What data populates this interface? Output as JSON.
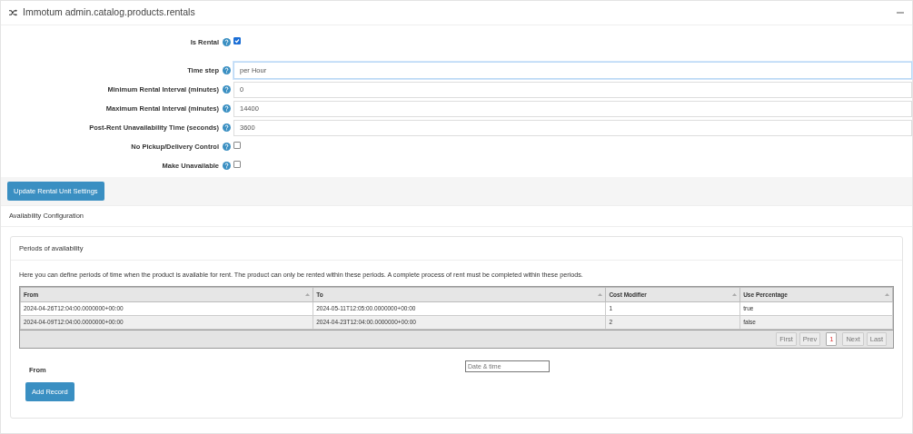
{
  "panel": {
    "title": "Immotum admin.catalog.products.rentals"
  },
  "form": {
    "fields": [
      {
        "kind": "checkbox",
        "label": "Is Rental",
        "checked": true
      },
      {
        "kind": "select",
        "label": "Time step",
        "value": "per Hour",
        "focused": true
      },
      {
        "kind": "text",
        "label": "Minimum Rental Interval (minutes)",
        "value": "0"
      },
      {
        "kind": "text",
        "label": "Maximum Rental Interval (minutes)",
        "value": "14400"
      },
      {
        "kind": "text",
        "label": "Post-Rent Unavailability Time (seconds)",
        "value": "3600"
      },
      {
        "kind": "checkbox",
        "label": "No Pickup/Delivery Control",
        "checked": false
      },
      {
        "kind": "checkbox",
        "label": "Make Unavailable",
        "checked": false
      }
    ],
    "submit": "Update Rental Unit Settings"
  },
  "availability": {
    "title": "Availability Configuration",
    "periods": {
      "title": "Periods of availability",
      "description": "Here you can define periods of time when the product is available for rent. The product can only be rented within these periods. A complete process of rent must be completed within these periods.",
      "table": {
        "columns": [
          "From",
          "To",
          "Cost Modifier",
          "Use Percentage"
        ],
        "rows": [
          [
            "2024-04-26T12:04:00.0000000+00:00",
            "2024-05-11T12:05:00.0000000+00:00",
            "1",
            "true"
          ],
          [
            "2024-04-09T12:04:00.0000000+00:00",
            "2024-04-23T12:04:00.0000000+00:00",
            "2",
            "false"
          ]
        ]
      },
      "pager": [
        {
          "label": "First",
          "selected": false,
          "disabled": true
        },
        {
          "label": "Prev",
          "selected": false,
          "disabled": true
        },
        {
          "label": "1",
          "selected": true,
          "disabled": false
        },
        {
          "label": "Next",
          "selected": false,
          "disabled": true
        },
        {
          "label": "Last",
          "selected": false,
          "disabled": true
        }
      ],
      "new_record": {
        "label": "From",
        "placeholder": "Date & time",
        "button": "Add Record"
      }
    }
  }
}
